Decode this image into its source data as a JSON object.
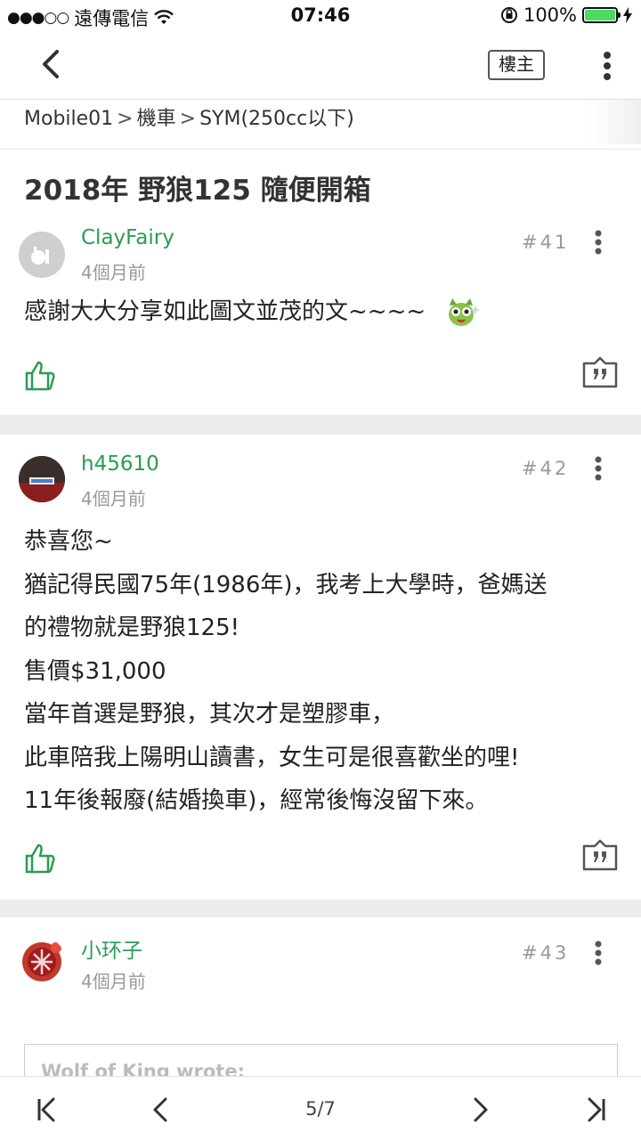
{
  "status_bar": {
    "carrier": "遠傳電信",
    "time": "07:46",
    "battery": "100%",
    "battery_level": 1.0
  },
  "nav": {
    "louzhu_label": "樓主"
  },
  "breadcrumb": [
    "Mobile01",
    "機車",
    "SYM(250cc以下)"
  ],
  "thread_title": "2018年 野狼125 隨便開箱",
  "posts": [
    {
      "username": "ClayFairy",
      "time": "4個月前",
      "floor": "#41",
      "lines": [
        "感謝大大分享如此圖文並茂的文~~~~"
      ]
    },
    {
      "username": "h45610",
      "time": "4個月前",
      "floor": "#42",
      "lines": [
        "恭喜您~",
        "猶記得民國75年(1986年)，我考上大學時，爸媽送",
        "的禮物就是野狼125!",
        "售價$31,000",
        "當年首選是野狼，其次才是塑膠車，",
        "此車陪我上陽明山讀書，女生可是很喜歡坐的哩!",
        "11年後報廢(結婚換車)，經常後悔沒留下來。"
      ]
    },
    {
      "username": "小环子",
      "time": "4個月前",
      "floor": "#43",
      "quote_author": "Wolf of King wrote:"
    }
  ],
  "pager": {
    "indicator": "5/7"
  },
  "colors": {
    "username": "#2a9d52",
    "like_icon": "#2a9d52",
    "battery_fill": "#4cd964"
  }
}
